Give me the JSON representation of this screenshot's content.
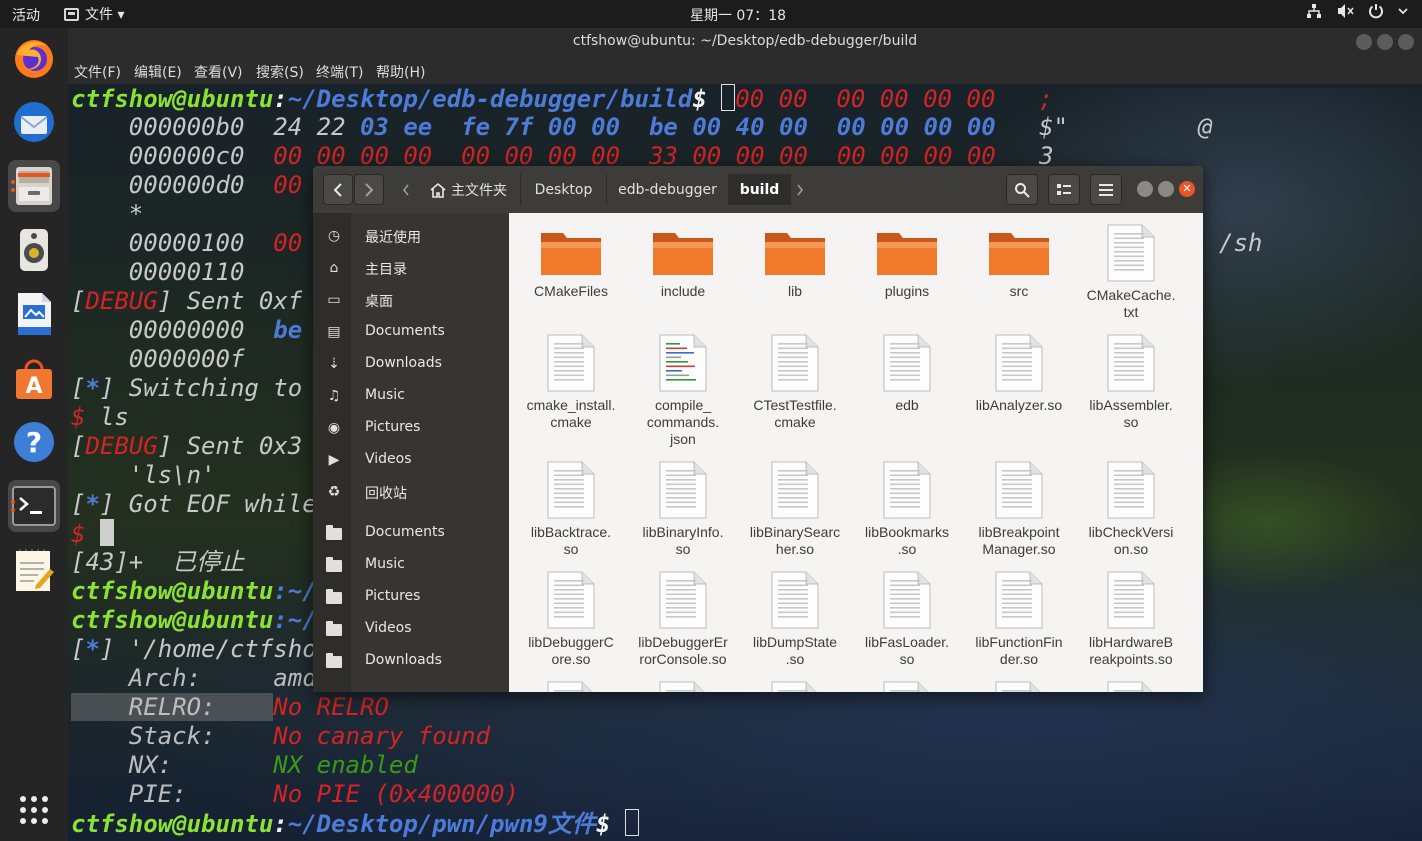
{
  "topbar": {
    "activities": "活动",
    "app_menu": "文件 ▾",
    "clock": "星期一 07：18",
    "tray": [
      "network-icon",
      "volume-icon",
      "power-icon"
    ]
  },
  "dock": [
    "firefox",
    "thunderbird",
    "files",
    "rhythmbox",
    "libreoffice-writer",
    "ubuntu-software",
    "help",
    "terminal",
    "text-editor",
    "show-applications"
  ],
  "terminal": {
    "title": "ctfshow@ubuntu: ~/Desktop/edb-debugger/build",
    "menu": [
      "文件(F)",
      "编辑(E)",
      "查看(V)",
      "搜索(S)",
      "终端(T)",
      "帮助(H)"
    ],
    "lines": {
      "l1_user": "ctfshow@ubuntu",
      "l1_colon": ":",
      "l1_path": "~/Desktop/edb-debugger/build",
      "l1_dollar": "$",
      "l1_tail": "00 00  00 00 00 00   ;",
      "l2_addr": "    000000b0  24 22 ",
      "l2_hex": "03 ee  fe 7f 00 00  be 00 40 00  00 00 00 00",
      "l2_ascii": "   $\"         @",
      "l3_addr": "    000000c0  ",
      "l3_hex": "00 00 00 00  00 00 00 00  33 00 00 00  00 00 00 00",
      "l3_ascii": "   3",
      "l4_addr": "    000000d0  ",
      "l4_hex": "00",
      "l5": "    *",
      "l6_addr": "    00000100  ",
      "l6_hex": "00",
      "l6_ascii": "/sh",
      "l7": "    00000110",
      "l8_open": "[",
      "l8_debug": "DEBUG",
      "l8_rest": "] Sent 0xf b",
      "l9_addr": "    00000000  ",
      "l9_hex": "be",
      "l10": "    0000000f",
      "l11_open": "[",
      "l11_star": "*",
      "l11_rest": "] Switching to i",
      "l12_dollar": "$",
      "l12_cmd": " ls",
      "l13_open": "[",
      "l13_debug": "DEBUG",
      "l13_rest": "] Sent 0x3 b",
      "l14": "    'ls\\n'",
      "l15_open": "[",
      "l15_star": "*",
      "l15_rest": "] Got EOF while",
      "l16_dollar": "$ ",
      "l17": "[43]+  已停止",
      "l18_user": "ctfshow@ubuntu",
      "l18_rest": ":~/",
      "l19_user": "ctfshow@ubuntu",
      "l19_rest": ":~/",
      "l20_open": "[",
      "l20_star": "*",
      "l20_rest": "] '/home/ctfshow",
      "l21_key": "    Arch:     ",
      "l21_val": "amd",
      "l22_key": "    RELRO:    ",
      "l22_val": "No RELRO",
      "l23_key": "    Stack:    ",
      "l23_val": "No canary found",
      "l24_key": "    NX:       ",
      "l24_val": "NX enabled",
      "l25_key": "    PIE:      ",
      "l25_val": "No PIE (0x400000)",
      "l26_user": "ctfshow@ubuntu",
      "l26_colon": ":",
      "l26_path": "~/Desktop/pwn/pwn9文件",
      "l26_dollar": "$ "
    }
  },
  "file_manager": {
    "breadcrumbs": [
      "主文件夹",
      "Desktop",
      "edb-debugger",
      "build"
    ],
    "sidebar": [
      {
        "icon": "clock-icon",
        "label": "最近使用"
      },
      {
        "icon": "home-icon",
        "label": "主目录"
      },
      {
        "icon": "desktop-icon",
        "label": "桌面"
      },
      {
        "icon": "documents-icon",
        "label": "Documents"
      },
      {
        "icon": "download-icon",
        "label": "Downloads"
      },
      {
        "icon": "music-icon",
        "label": "Music"
      },
      {
        "icon": "camera-icon",
        "label": "Pictures"
      },
      {
        "icon": "video-icon",
        "label": "Videos"
      },
      {
        "icon": "trash-icon",
        "label": "回收站"
      },
      {
        "icon": "folder-icon",
        "label": "Documents"
      },
      {
        "icon": "folder-icon",
        "label": "Music"
      },
      {
        "icon": "folder-icon",
        "label": "Pictures"
      },
      {
        "icon": "folder-icon",
        "label": "Videos"
      },
      {
        "icon": "folder-icon",
        "label": "Downloads"
      }
    ],
    "files": [
      {
        "name": "CMakeFiles",
        "type": "folder"
      },
      {
        "name": "include",
        "type": "folder"
      },
      {
        "name": "lib",
        "type": "folder"
      },
      {
        "name": "plugins",
        "type": "folder"
      },
      {
        "name": "src",
        "type": "folder"
      },
      {
        "name": "CMakeCache.\ntxt",
        "type": "file"
      },
      {
        "name": "cmake_install.\ncmake",
        "type": "file"
      },
      {
        "name": "compile_\ncommands.\njson",
        "type": "json"
      },
      {
        "name": "CTestTestfile.\ncmake",
        "type": "file"
      },
      {
        "name": "edb",
        "type": "file"
      },
      {
        "name": "libAnalyzer.so",
        "type": "file"
      },
      {
        "name": "libAssembler.\nso",
        "type": "file"
      },
      {
        "name": "libBacktrace.\nso",
        "type": "file"
      },
      {
        "name": "libBinaryInfo.\nso",
        "type": "file"
      },
      {
        "name": "libBinarySearc\nher.so",
        "type": "file"
      },
      {
        "name": "libBookmarks\n.so",
        "type": "file"
      },
      {
        "name": "libBreakpoint\nManager.so",
        "type": "file"
      },
      {
        "name": "libCheckVersi\non.so",
        "type": "file"
      },
      {
        "name": "libDebuggerC\nore.so",
        "type": "file"
      },
      {
        "name": "libDebuggerEr\nrorConsole.so",
        "type": "file"
      },
      {
        "name": "libDumpState\n.so",
        "type": "file"
      },
      {
        "name": "libFasLoader.\nso",
        "type": "file"
      },
      {
        "name": "libFunctionFin\nder.so",
        "type": "file"
      },
      {
        "name": "libHardwareB\nreakpoints.so",
        "type": "file"
      },
      {
        "name": "",
        "type": "file"
      },
      {
        "name": "",
        "type": "file"
      },
      {
        "name": "",
        "type": "file"
      },
      {
        "name": "",
        "type": "file"
      },
      {
        "name": "",
        "type": "file"
      },
      {
        "name": "",
        "type": "file"
      }
    ]
  }
}
